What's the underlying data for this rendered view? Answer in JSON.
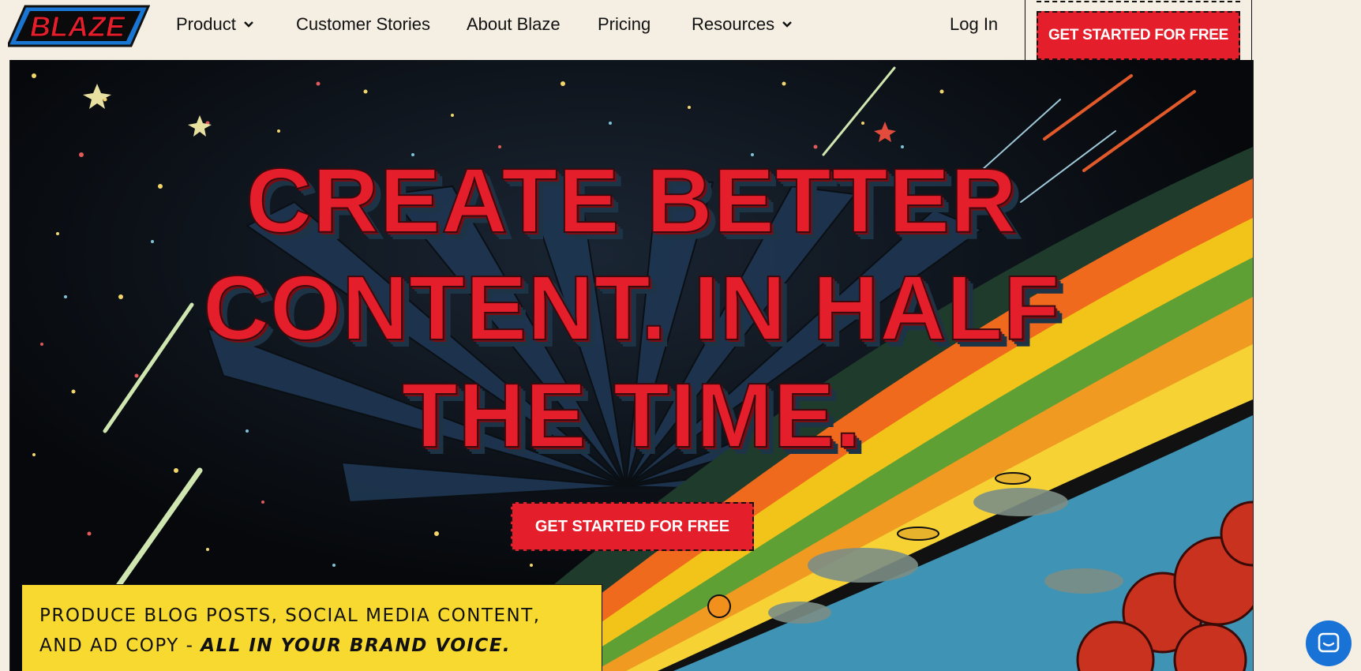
{
  "nav": {
    "logo_text": "BLAZE",
    "items": [
      {
        "label": "Product",
        "icon": "chevron-down-icon"
      },
      {
        "label": "Customer Stories"
      },
      {
        "label": "About Blaze"
      },
      {
        "label": "Pricing"
      },
      {
        "label": "Resources",
        "icon": "chevron-down-icon"
      }
    ],
    "login": "Log In",
    "cta": "GET STARTED FOR FREE"
  },
  "hero": {
    "headline": [
      "CREATE BETTER",
      "CONTENT. IN HALF",
      "THE TIME."
    ],
    "cta": "GET STARTED FOR FREE",
    "caption_prefix": "PRODUCE BLOG POSTS, SOCIAL MEDIA CONTENT, AND AD COPY - ",
    "caption_emphasis": "ALL IN YOUR BRAND VOICE."
  },
  "chat": {
    "icon": "chat-icon"
  },
  "colors": {
    "background": "#f4eee3",
    "accent_red": "#e41e2b",
    "caption_yellow": "#f8d92f",
    "chat_blue": "#1973d6",
    "space_black": "#07090c"
  }
}
